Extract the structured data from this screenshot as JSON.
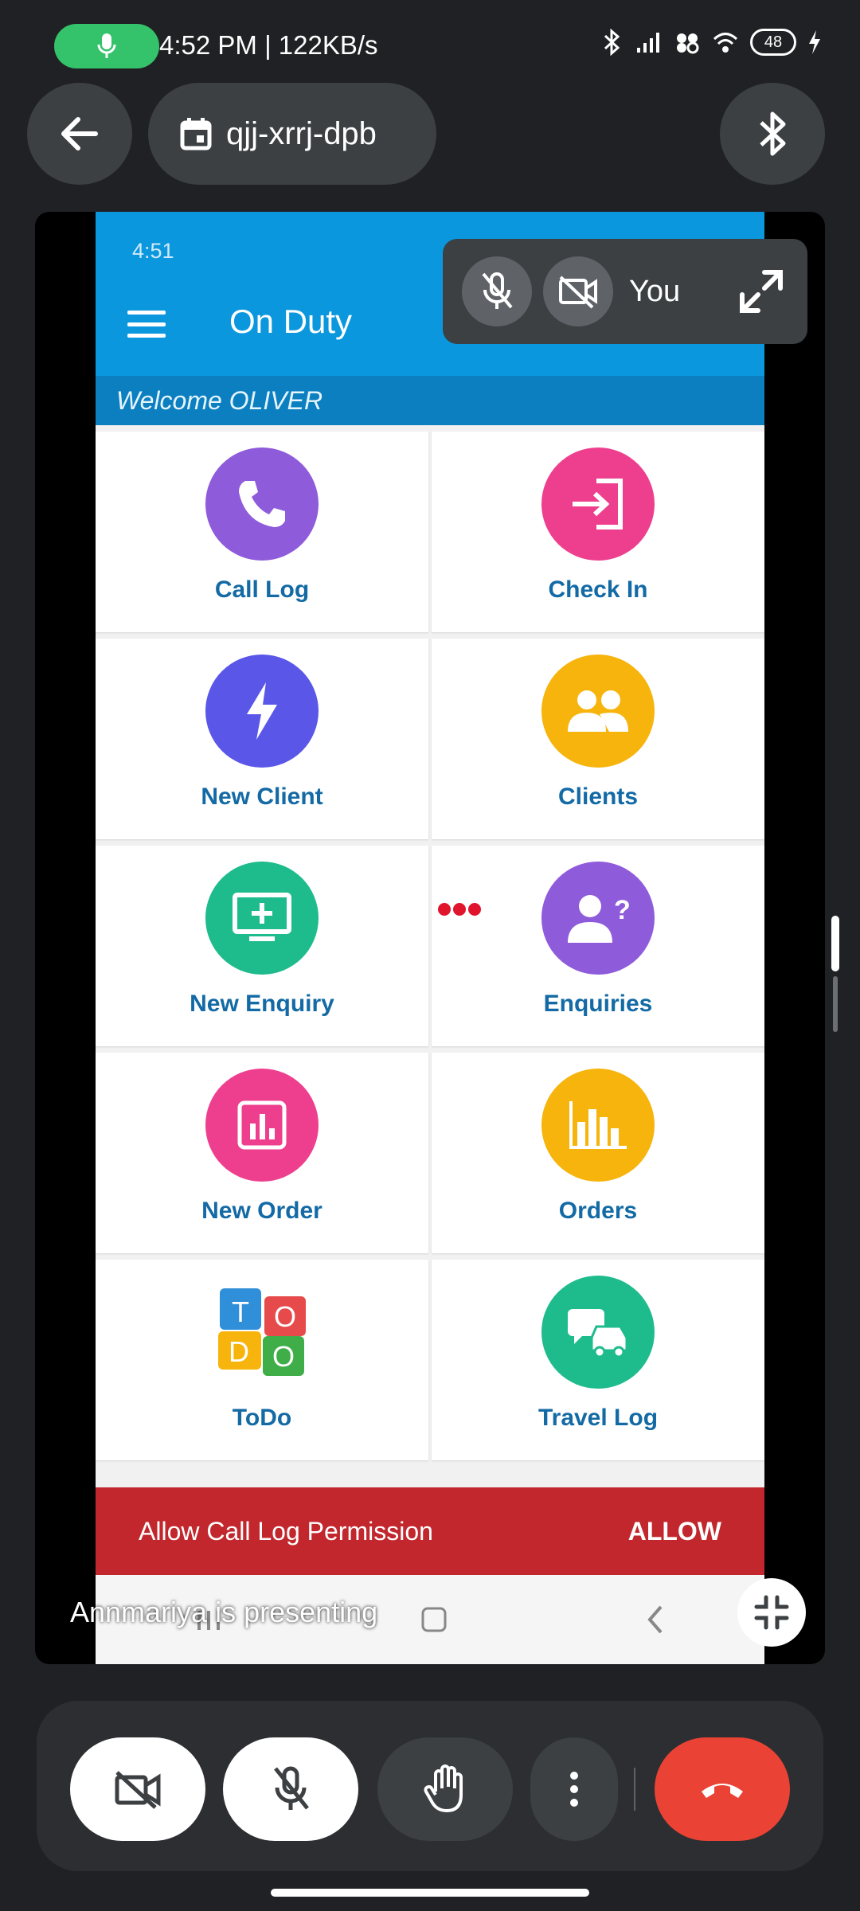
{
  "status_bar": {
    "time_speed": "4:52 PM | 122KB/s",
    "battery": "48"
  },
  "meeting": {
    "code": "qjj-xrrj-dpb"
  },
  "shared_screen": {
    "phone_time": "4:51",
    "app_title": "On Duty",
    "welcome": "Welcome OLIVER",
    "tiles": [
      {
        "label": "Call Log",
        "color": "#8e5bdb",
        "icon": "phone-icon"
      },
      {
        "label": "Check In",
        "color": "#ee3f8e",
        "icon": "login-icon"
      },
      {
        "label": "New Client",
        "color": "#5a57e8",
        "icon": "lightning-icon"
      },
      {
        "label": "Clients",
        "color": "#f6b40c",
        "icon": "people-icon"
      },
      {
        "label": "New Enquiry",
        "color": "#1ebb8c",
        "icon": "monitor-plus-icon"
      },
      {
        "label": "Enquiries",
        "color": "#8e5bdb",
        "icon": "person-question-icon"
      },
      {
        "label": "New Order",
        "color": "#ee3f8e",
        "icon": "chart-icon"
      },
      {
        "label": "Orders",
        "color": "#f6b40c",
        "icon": "bar-chart-icon"
      },
      {
        "label": "ToDo",
        "color": "",
        "icon": "todo-blocks-icon"
      },
      {
        "label": "Travel Log",
        "color": "#1ebb8c",
        "icon": "travel-icon"
      }
    ],
    "permission_text": "Allow Call Log Permission",
    "permission_action": "ALLOW",
    "todo_letters": [
      "T",
      "O",
      "D",
      "O"
    ]
  },
  "self_view": {
    "label": "You"
  },
  "presenting_text": "Annmariya is presenting",
  "colors": {
    "app_blue": "#0b97dd",
    "permission_red": "#c1272d",
    "end_call_red": "#ea4335",
    "mic_active_green": "#34c26b"
  }
}
